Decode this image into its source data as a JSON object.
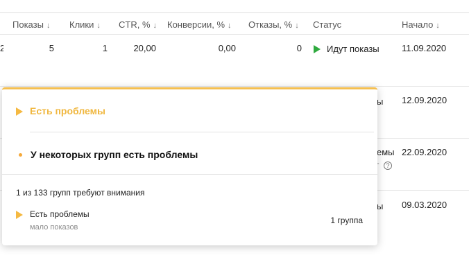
{
  "table": {
    "headers": [
      {
        "label": "Показы",
        "arrow": "↓"
      },
      {
        "label": "Клики",
        "arrow": "↓"
      },
      {
        "label": "CTR, %",
        "arrow": "↓"
      },
      {
        "label": "Конверсии, %",
        "arrow": "↓"
      },
      {
        "label": "Отказы, %",
        "arrow": "↓"
      },
      {
        "label": "Статус",
        "arrow": ""
      },
      {
        "label": "Начало",
        "arrow": "↓"
      }
    ],
    "rows": [
      {
        "edge": "2",
        "shows": "5",
        "clicks": "1",
        "ctr": "20,00",
        "conversions": "0,00",
        "bounces": "0",
        "status": "Идут показы",
        "start": "11.09.2020"
      },
      {
        "edge": "",
        "shows": "",
        "clicks": "",
        "ctr": "",
        "conversions": "",
        "bounces": "",
        "status": "ы",
        "start": "12.09.2020"
      },
      {
        "edge": "",
        "shows": "",
        "clicks": "",
        "ctr": "",
        "conversions": "",
        "bounces": "",
        "status": "емы",
        "status_extra": "-",
        "start": "22.09.2020"
      },
      {
        "edge": "",
        "shows": "",
        "clicks": "",
        "ctr": "",
        "conversions": "",
        "bounces": "",
        "status": "ы",
        "start": "09.03.2020"
      }
    ],
    "help_icon": "question-circle-icon"
  },
  "popup": {
    "title": "Есть проблемы",
    "subtitle": "У некоторых групп есть проблемы",
    "groups_summary": "1 из 133 групп требуют внимания",
    "item": {
      "label": "Есть проблемы",
      "sublabel": "мало показов",
      "count": "1 группа"
    },
    "accent_color": "#f5bf4f"
  },
  "colors": {
    "status_active": "#2faa3f",
    "warning": "#f5b942"
  }
}
